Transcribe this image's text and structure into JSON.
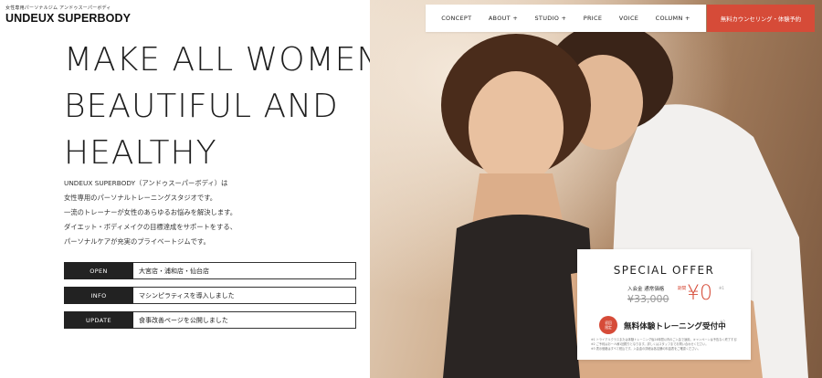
{
  "brand": {
    "tagline": "女性専用パーソナルジム アンドゥスーパーボディ",
    "name": "UNDEUX SUPERBODY"
  },
  "headline": [
    "MAKE ALL WOMEN",
    "BEAUTIFUL AND",
    "HEALTHY"
  ],
  "intro": [
    "UNDEUX SUPERBODY（アンドゥスーパーボディ）は",
    "女性専用のパーソナルトレーニングスタジオです。",
    "一流のトレーナーが女性のあらゆるお悩みを解決します。",
    "ダイエット・ボディメイクの目標達成をサポートをする、",
    "パーソナルケアが充実のプライベートジムです。"
  ],
  "news": [
    {
      "label": "OPEN",
      "text": "大宮店・浦和店・仙台店"
    },
    {
      "label": "INFO",
      "text": "マシンピラティスを導入しました"
    },
    {
      "label": "UPDATE",
      "text": "食事改善ページを公開しました"
    }
  ],
  "nav": {
    "items": [
      "CONCEPT",
      "ABOUT +",
      "STUDIO +",
      "PRICE",
      "VOICE",
      "COLUMN +"
    ],
    "cta": "無料カウンセリング・体験予約"
  },
  "offer": {
    "title": "SPECIAL OFFER",
    "sub": "入会金 通常価格",
    "old_price": "¥33,000",
    "now_tag": "期間",
    "price": "¥0",
    "note_mark": "※1",
    "badge": [
      "初回",
      "限定"
    ],
    "trial": "無料体験トレーニング受付中",
    "trial_mark": "※2",
    "notes": [
      "※1 トライアルクラスまたは体験トレーニング後24時間以内のご入会で適用。キャンペーンは予告なく終了する場合があります。",
      "※2 ご予約はお一人様1回限りとなります。詳しくはスタッフまでお問い合わせください。",
      "※3 表示価格はすべて税込です。入会金の詳細は各店舗の料金表をご確認ください。"
    ]
  },
  "colors": {
    "accent": "#d64b38",
    "dark": "#222222"
  }
}
